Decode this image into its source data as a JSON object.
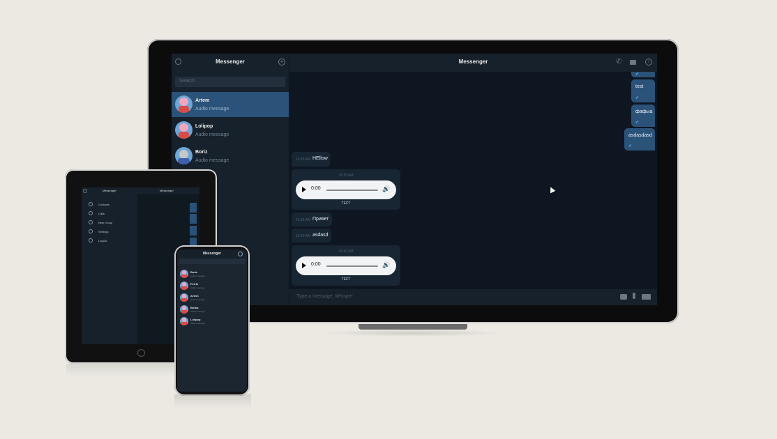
{
  "laptop": {
    "sidebar": {
      "title": "Messenger",
      "search_placeholder": "Search",
      "dialogs": [
        {
          "name": "Artem",
          "preview": "Audio message",
          "active": true
        },
        {
          "name": "Lolipop",
          "preview": "Audio message",
          "active": false
        },
        {
          "name": "Boriz",
          "preview": "Audio message",
          "active": false
        }
      ]
    },
    "chat": {
      "title": "Messenger",
      "outgoing": [
        {
          "text": "test",
          "status": "✔"
        },
        {
          "text": "фафыа",
          "status": "✔"
        },
        {
          "text": "asdasdasd",
          "status": "✔"
        }
      ],
      "incoming": [
        {
          "time": "16:35 AM",
          "text": "HEllow"
        },
        {
          "time": "16:35 AM",
          "text": "Привет"
        },
        {
          "time": "16:40 AM",
          "text": "asdasd"
        }
      ],
      "audio_messages": [
        {
          "time": "16:35 AM",
          "player_time": "0:00",
          "caption": "ТЕСТ"
        },
        {
          "time": "16:40 AM",
          "player_time": "0:00",
          "caption": "ТЕСТ"
        }
      ],
      "composer_placeholder": "Type a message, Whisper"
    }
  },
  "tablet": {
    "sidebar_title": "Messenger",
    "chat_title": "Messenger",
    "menu": [
      {
        "label": "Contacts",
        "icon": "user-icon"
      },
      {
        "label": "Calls",
        "icon": "phone-icon"
      },
      {
        "label": "New Group",
        "icon": "group-icon"
      },
      {
        "label": "Settings",
        "icon": "gear-icon"
      },
      {
        "label": "Logout",
        "icon": "logout-icon"
      }
    ]
  },
  "phone": {
    "title": "Messenger",
    "dialogs": [
      {
        "name": "Boriz",
        "preview": "Audio message"
      },
      {
        "name": "Petrik",
        "preview": "Audio message"
      },
      {
        "name": "Artem",
        "preview": "Audio message"
      },
      {
        "name": "Borka",
        "preview": "Audio message"
      },
      {
        "name": "Lolipop",
        "preview": "Audio message"
      }
    ]
  },
  "colors": {
    "background": "#ebe9e2",
    "panel": "#17212b",
    "chat_bg": "#0e1621",
    "accent": "#2b5278",
    "check": "#68c3ff"
  }
}
